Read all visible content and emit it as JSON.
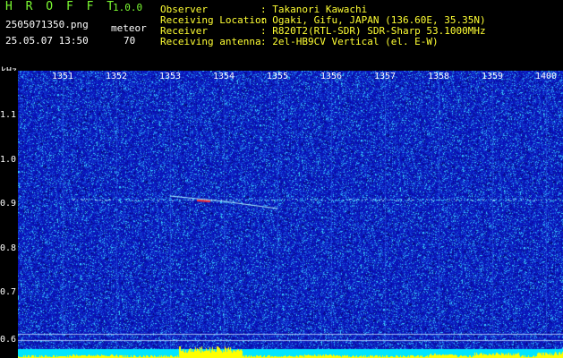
{
  "header": {
    "logo": "H R O F F T",
    "version": "1.0.0",
    "filename": "2505071350.png",
    "meteor_label": "meteor",
    "datetime": "25.05.07 13:50",
    "meteor_count": "70"
  },
  "info": [
    {
      "label": "Observer",
      "value": ": Takanori Kawachi"
    },
    {
      "label": "Receiving Location",
      "value": ": Ogaki, Gifu, JAPAN (136.60E, 35.35N)"
    },
    {
      "label": "Receiver",
      "value": ": R820T2(RTL-SDR) SDR-Sharp 53.1000MHz"
    },
    {
      "label": "Receiving antenna",
      "value": ": 2el-HB9CV Vertical (el. E-W)"
    }
  ],
  "axes": {
    "y_unit": "kHz",
    "y_ticks": [
      "1.1",
      "1.0",
      "0.9",
      "0.8",
      "0.7",
      "0.6"
    ],
    "x_ticks": [
      "1351",
      "1352",
      "1353",
      "1354",
      "1355",
      "1356",
      "1357",
      "1358",
      "1359",
      "1400"
    ]
  },
  "colors": {
    "background": "#0a10b8",
    "noise_cyan": "#3ad0ff",
    "trace": "#aef6ff",
    "meteor_head": "#ff3030",
    "bottom_band": "#00e5ff",
    "bottom_peak": "#ffff00"
  }
}
